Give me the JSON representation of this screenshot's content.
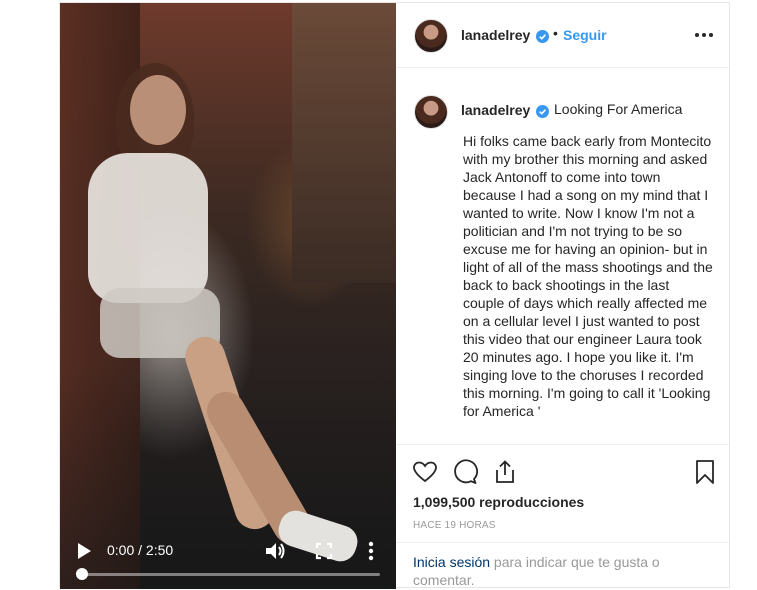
{
  "header": {
    "username": "lanadelrey",
    "follow_label": "Seguir"
  },
  "caption": {
    "username": "lanadelrey",
    "title": "Looking For America",
    "body": "Hi folks came back early from Montecito with my brother this morning and asked Jack Antonoff to come into town because I had a song on my mind that I wanted to write. Now I know I'm not a politician and I'm not trying to be so excuse me for having an opinion- but in light of all of the mass shootings and the back to back shootings in the last couple of days which really affected me on a cellular level I just wanted to post this video that our engineer Laura took 20 minutes ago. I hope you like it. I'm singing love to the choruses I recorded this morning. I'm going to call it 'Looking for America '"
  },
  "video": {
    "time_display": "0:00 / 2:50",
    "progress": 0.0
  },
  "stats": {
    "views": "1,099,500 reproducciones",
    "time_ago": "HACE 19 HORAS"
  },
  "login": {
    "link": "Inicia sesión",
    "rest": " para indicar que te gusta o comentar."
  },
  "colors": {
    "accent": "#3897f0",
    "verified": "#3897f0",
    "link_dark": "#003569",
    "muted": "#999999"
  },
  "icons": [
    "play-icon",
    "volume-icon",
    "fullscreen-icon",
    "more-vertical-icon",
    "verified-badge-icon",
    "options-icon",
    "heart-icon",
    "comment-icon",
    "share-icon",
    "bookmark-icon"
  ]
}
